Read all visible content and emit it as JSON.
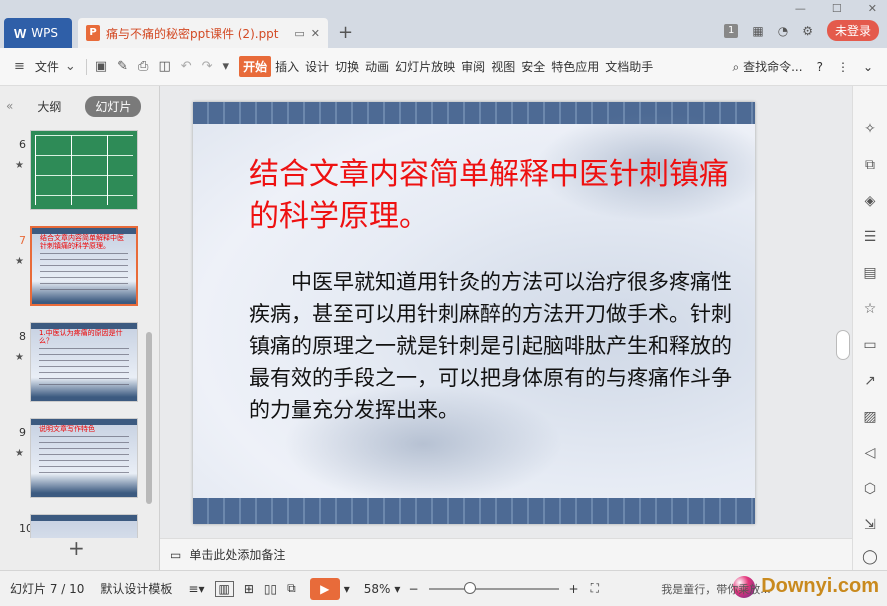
{
  "titlebar": {
    "app_tab": "WPS",
    "doc_tab_title": "痛与不痛的秘密ppt课件 (2).ppt",
    "doc_badge": "P",
    "new_tab_symbol": "+",
    "page_count_badge": "1",
    "login_button": "未登录"
  },
  "menubar": {
    "file": "文件",
    "start": "开始",
    "items": [
      "插入",
      "设计",
      "切换",
      "动画",
      "幻灯片放映",
      "审阅",
      "视图",
      "安全",
      "特色应用",
      "文档助手"
    ],
    "search": "查找命令...",
    "help": "?"
  },
  "left_panel": {
    "tab_outline": "大纲",
    "tab_slides": "幻灯片",
    "thumbnails": [
      {
        "num": "6",
        "text": ""
      },
      {
        "num": "7",
        "text": "结合文章内容简单解释中医针刺镇痛的科学原理。"
      },
      {
        "num": "8",
        "text": "1.中医认为疼痛的原因是什么？"
      },
      {
        "num": "9",
        "text": "说明文章写作特色"
      },
      {
        "num": "10",
        "text": ""
      }
    ]
  },
  "slide": {
    "title": "结合文章内容简单解释中医针刺镇痛的科学原理。",
    "body": "中医早就知道用针灸的方法可以治疗很多疼痛性疾病，甚至可以用针刺麻醉的方法开刀做手术。针刺镇痛的原理之一就是针刺是引起脑啡肽产生和释放的最有效的手段之一，可以把身体原有的与疼痛作斗争的力量充分发挥出来。",
    "title_color": "#ee1111"
  },
  "notes": {
    "placeholder": "单击此处添加备注"
  },
  "statusbar": {
    "slide_counter": "幻灯片 7 / 10",
    "template": "默认设计模板",
    "zoom": "58%",
    "zoom_fraction": 0.3,
    "watermark": "Downyi.com",
    "watermark_sub": "我是童行，带你乘放..."
  },
  "colors": {
    "accent": "#e86b3a",
    "wps_blue": "#2f5fa8",
    "login_red": "#e45a4c"
  }
}
